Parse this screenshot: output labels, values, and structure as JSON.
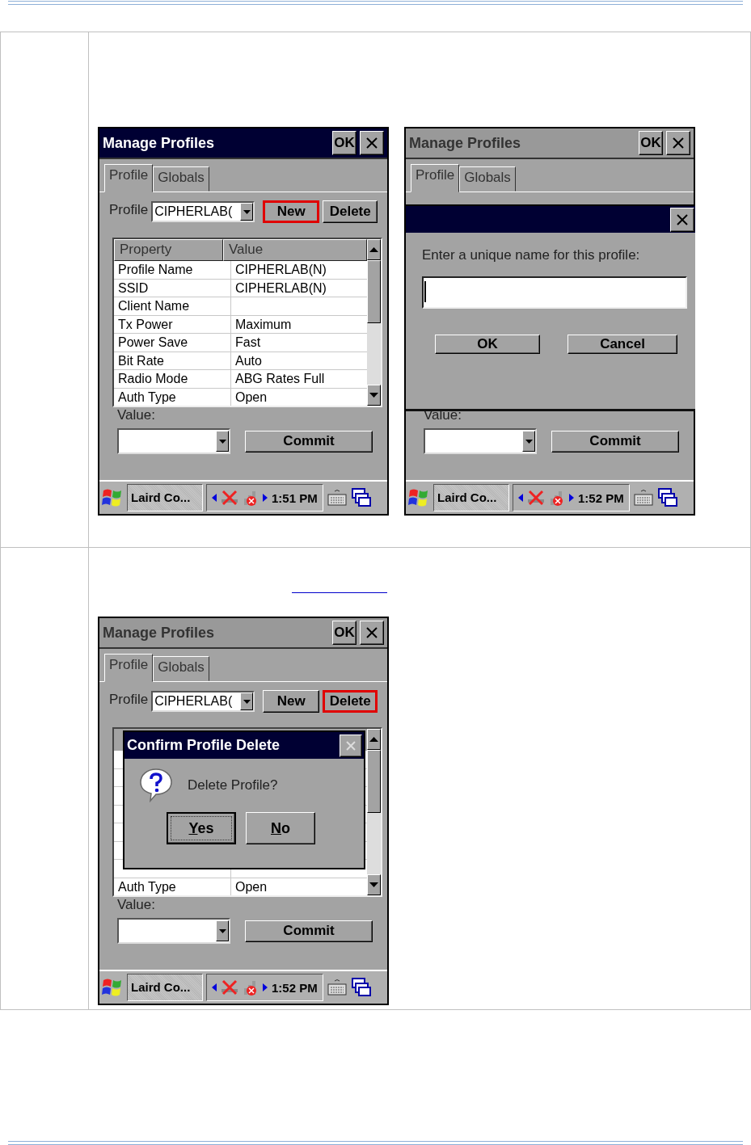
{
  "page_rows": [
    {
      "screens": [
        {
          "title": "Manage Profiles",
          "title_active": true,
          "ok": "OK",
          "tabs": [
            {
              "label": "Profile",
              "selected": true
            },
            {
              "label": "Globals",
              "selected": false
            }
          ],
          "profile_row": {
            "label": "Profile",
            "combo_value": "CIPHERLAB(",
            "buttons": [
              {
                "label": "New",
                "highlighted": true
              },
              {
                "label": "Delete",
                "highlighted": false
              }
            ]
          },
          "table": {
            "columns": [
              "Property",
              "Value"
            ],
            "rows": [
              [
                "Profile Name",
                "CIPHERLAB(N)"
              ],
              [
                "SSID",
                "CIPHERLAB(N)"
              ],
              [
                "Client Name",
                ""
              ],
              [
                "Tx Power",
                "Maximum"
              ],
              [
                "Power Save",
                "Fast"
              ],
              [
                "Bit Rate",
                "Auto"
              ],
              [
                "Radio Mode",
                "ABG Rates Full"
              ],
              [
                "Auth Type",
                "Open"
              ]
            ]
          },
          "value_label": "Value:",
          "commit": "Commit",
          "taskbar": {
            "app": "Laird Co...",
            "time": "1:51 PM"
          }
        },
        {
          "title": "Manage Profiles",
          "title_active": false,
          "ok": "OK",
          "tabs": [
            {
              "label": "Profile",
              "selected": true
            },
            {
              "label": "Globals",
              "selected": false
            }
          ],
          "value_label": "Value:",
          "commit": "Commit",
          "taskbar": {
            "app": "Laird Co...",
            "time": "1:52 PM"
          },
          "dialog": {
            "kind": "input",
            "prompt": "Enter a unique name for this profile:",
            "buttons": [
              "OK",
              "Cancel"
            ]
          }
        }
      ]
    },
    {
      "screens": [
        {
          "title": "Manage Profiles",
          "title_active": false,
          "ok": "OK",
          "tabs": [
            {
              "label": "Profile",
              "selected": true
            },
            {
              "label": "Globals",
              "selected": false
            }
          ],
          "profile_row": {
            "label": "Profile",
            "combo_value": "CIPHERLAB(",
            "buttons": [
              {
                "label": "New",
                "highlighted": false
              },
              {
                "label": "Delete",
                "highlighted": true
              }
            ]
          },
          "table": {
            "rows": [
              [
                "Auth Type",
                "Open"
              ]
            ]
          },
          "value_label": "Value:",
          "commit": "Commit",
          "taskbar": {
            "app": "Laird Co...",
            "time": "1:52 PM"
          },
          "dialog": {
            "kind": "confirm",
            "title": "Confirm Profile Delete",
            "message": "Delete Profile?",
            "buttons": [
              {
                "label": "Yes",
                "focused": true
              },
              {
                "label": "No",
                "focused": false
              }
            ]
          }
        }
      ]
    }
  ]
}
